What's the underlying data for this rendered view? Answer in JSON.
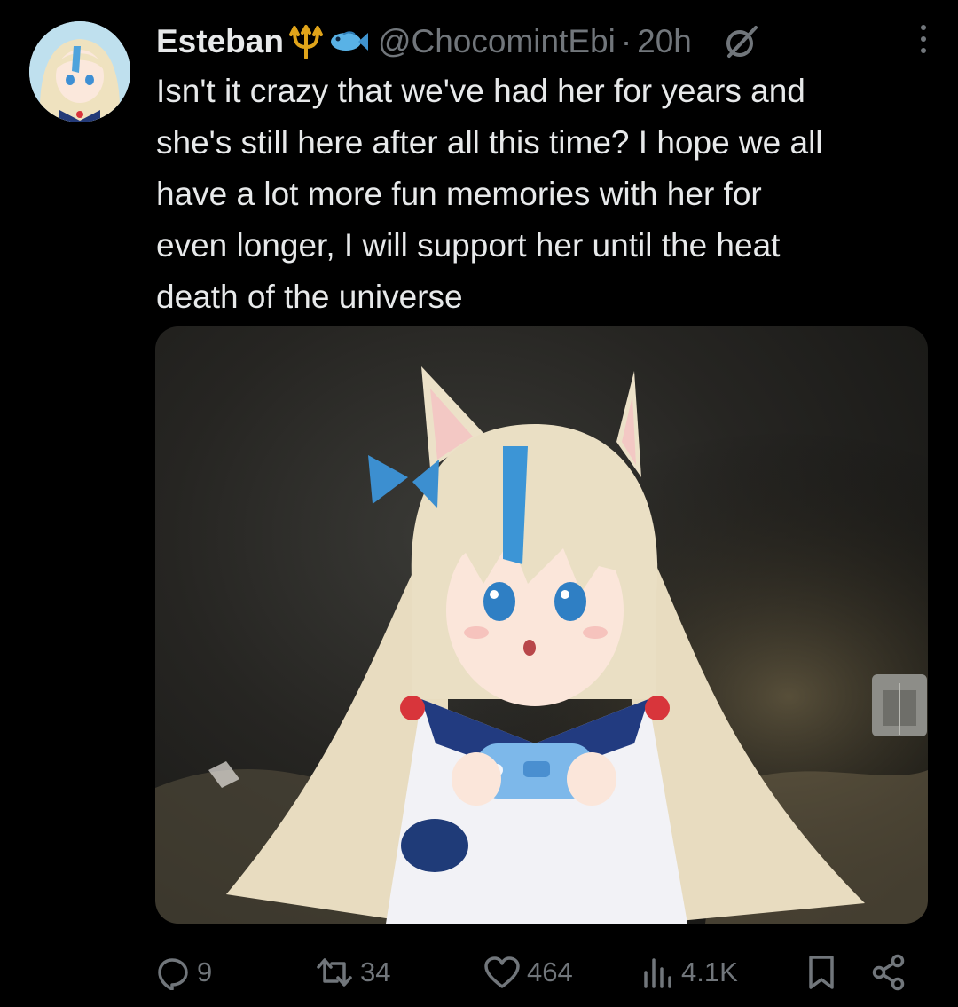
{
  "author": {
    "display_name": "Esteban",
    "emoji_icons": [
      "trident-icon",
      "fish-icon"
    ],
    "handle": "@ChocomintEbi",
    "separator": "·",
    "time": "20h"
  },
  "tweet": {
    "lines": [
      "Isn't it crazy that we've had her for years and",
      "she's still here after all this time? I hope we all",
      "have a lot more fun memories with her for",
      "even longer, I will support her until the heat",
      "death of the universe"
    ]
  },
  "actions": {
    "replies": "9",
    "retweets": "34",
    "likes": "464",
    "views": "4.1K"
  },
  "colors": {
    "background": "#000000",
    "text": "#e7e9ea",
    "muted": "#71767b",
    "accent_blue": "#3aa0e0"
  }
}
